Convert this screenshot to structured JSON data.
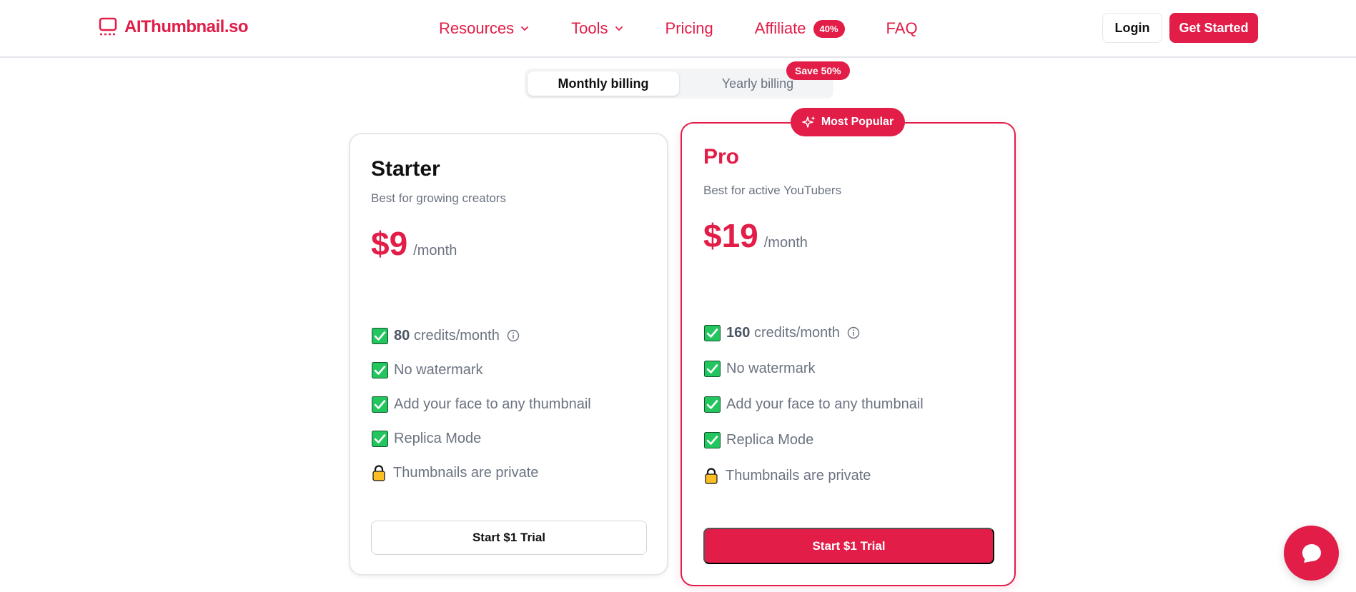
{
  "brand": {
    "name": "AIThumbnail.so",
    "color": "#e11d48"
  },
  "nav": {
    "resources": "Resources",
    "tools": "Tools",
    "pricing": "Pricing",
    "affiliate": "Affiliate",
    "affiliate_badge": "40%",
    "faq": "FAQ"
  },
  "header_actions": {
    "login": "Login",
    "get_started": "Get Started"
  },
  "billing": {
    "monthly": "Monthly billing",
    "yearly": "Yearly billing",
    "save_badge": "Save 50%",
    "selected": "Monthly billing"
  },
  "plans": {
    "starter": {
      "name": "Starter",
      "desc": "Best for growing creators",
      "price": "$9",
      "period": "/month",
      "credits_num": "80",
      "credits_label": "credits/month",
      "features": [
        "No watermark",
        "Add your face to any thumbnail",
        "Replica Mode"
      ],
      "private": "Thumbnails are private",
      "cta": "Start $1 Trial"
    },
    "pro": {
      "badge": "Most Popular",
      "name": "Pro",
      "desc": "Best for active YouTubers",
      "price": "$19",
      "period": "/month",
      "credits_num": "160",
      "credits_label": "credits/month",
      "features": [
        "No watermark",
        "Add your face to any thumbnail",
        "Replica Mode"
      ],
      "private": "Thumbnails are private",
      "cta": "Start $1 Trial"
    }
  },
  "icons": {
    "logo": "monitor-icon",
    "chevron": "chevron-down-icon",
    "check": "check-box-icon",
    "lock": "lock-icon",
    "info": "info-icon",
    "sparkle": "sparkles-icon",
    "chat": "chat-bubble-icon"
  }
}
